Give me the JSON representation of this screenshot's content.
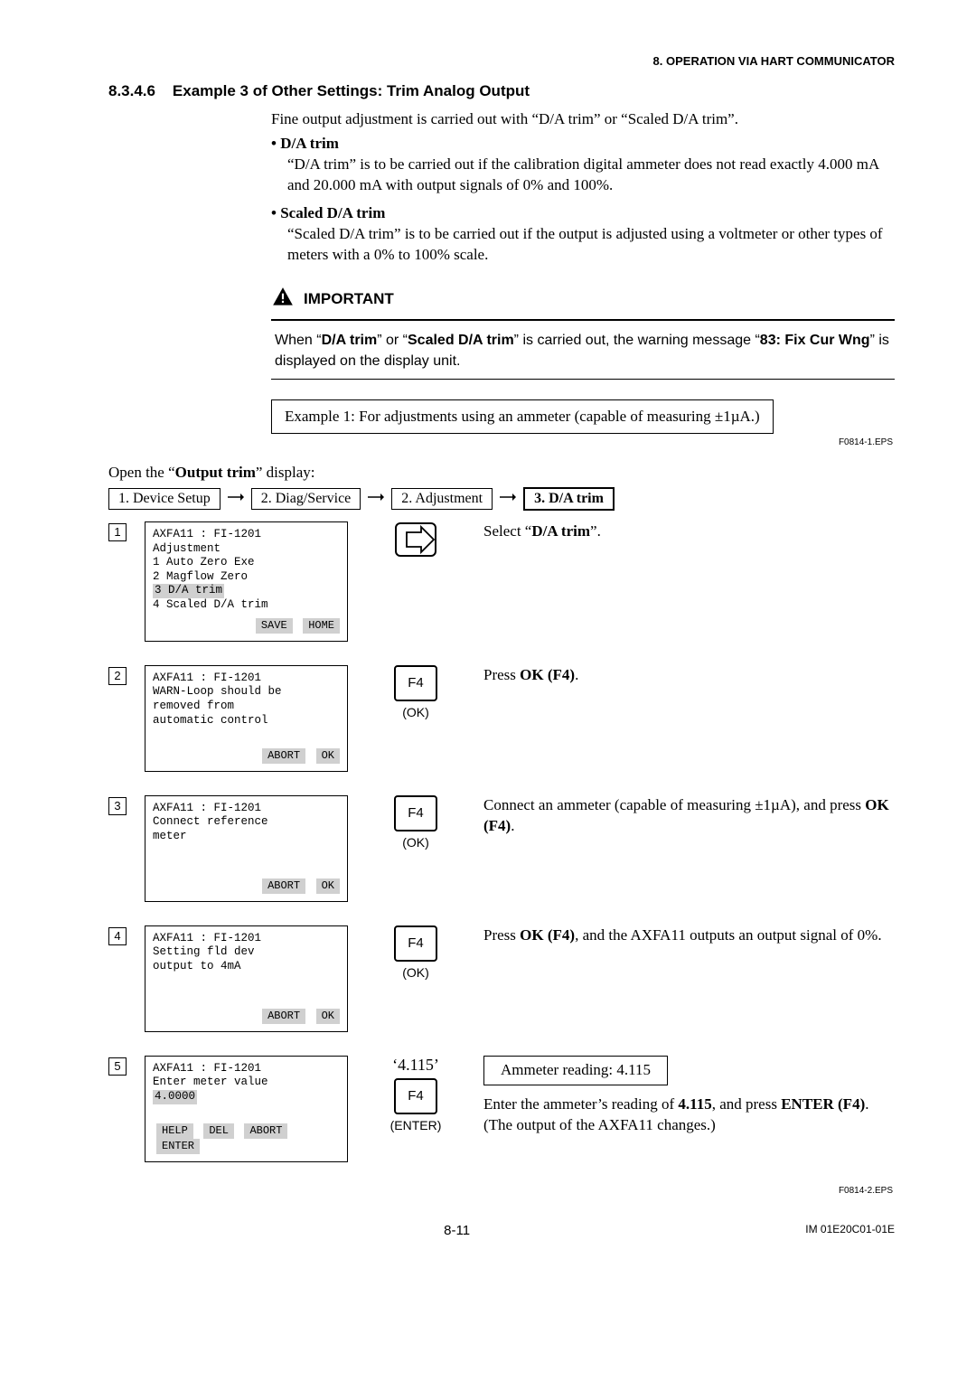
{
  "header": {
    "chapter": "8.  OPERATION VIA HART COMMUNICATOR"
  },
  "section": {
    "number": "8.3.4.6",
    "title": "Example 3 of Other Settings: Trim Analog Output",
    "intro": "Fine output adjustment is carried out with “D/A trim” or “Scaled D/A trim”.",
    "bullets": [
      {
        "title": "D/A trim",
        "body": "“D/A trim” is to be carried out if the calibration digital ammeter does not read exactly 4.000 mA and 20.000 mA with output signals of 0% and 100%."
      },
      {
        "title": "Scaled D/A trim",
        "body": "“Scaled D/A trim” is to be carried out if the output is adjusted using a voltmeter or other types of meters with a 0% to 100% scale."
      }
    ]
  },
  "important": {
    "label": "IMPORTANT",
    "body_pre": "When “",
    "kw1": "D/A trim",
    "mid1": "” or “",
    "kw2": "Scaled D/A trim",
    "mid2": "” is carried out, the warning message “",
    "kw3": "83: Fix Cur Wng",
    "body_post": "” is displayed on the display unit."
  },
  "example_box": "Example 1: For adjustments using an ammeter (capable of measuring ±1µA.)",
  "eps1": "F0814-1.EPS",
  "open_display_pre": "Open the “",
  "open_display_kw": "Output trim",
  "open_display_post": "” display:",
  "breadcrumb": [
    "1. Device Setup",
    "2. Diag/Service",
    "2. Adjustment",
    "3.  D/A trim"
  ],
  "steps": [
    {
      "n": "1",
      "screen_lines": [
        "AXFA11 : FI-1201",
        "Adjustment",
        " 1 Auto Zero Exe",
        " 2 Magflow Zero"
      ],
      "screen_sel": " 3 D/A trim",
      "screen_after": [
        " 4 Scaled D/A trim"
      ],
      "buttons": [
        "SAVE",
        "HOME"
      ],
      "key_type": "arrow",
      "desc_plain": "Select “",
      "desc_bold": "D/A trim",
      "desc_tail": "”."
    },
    {
      "n": "2",
      "screen_lines": [
        "AXFA11 : FI-1201",
        "WARN-Loop should be",
        "removed from",
        "automatic control"
      ],
      "buttons": [
        "ABORT",
        "OK"
      ],
      "key_type": "f4",
      "key": "F4",
      "key_label": "(OK)",
      "desc_plain": "Press ",
      "desc_bold": "OK (F4)",
      "desc_tail": "."
    },
    {
      "n": "3",
      "screen_lines": [
        "AXFA11 : FI-1201",
        "Connect reference",
        "meter"
      ],
      "buttons": [
        "ABORT",
        "OK"
      ],
      "key_type": "f4",
      "key": "F4",
      "key_label": "(OK)",
      "desc_plain": "Connect an ammeter (capable of measuring ±1µA), and press ",
      "desc_bold": "OK (F4)",
      "desc_tail": "."
    },
    {
      "n": "4",
      "screen_lines": [
        "AXFA11 : FI-1201",
        "Setting fld dev",
        "output to 4mA"
      ],
      "buttons": [
        "ABORT",
        "OK"
      ],
      "key_type": "f4",
      "key": "F4",
      "key_label": "(OK)",
      "desc_plain": "Press ",
      "desc_bold": "OK (F4)",
      "desc_tail": ", and the AXFA11 outputs an output signal of 0%."
    },
    {
      "n": "5",
      "screen_lines": [
        "AXFA11 : FI-1201",
        "Enter meter value"
      ],
      "screen_hl": "       4.0000",
      "buttons_left": [
        "HELP",
        "DEL",
        "ABORT",
        "ENTER"
      ],
      "key_type": "typed",
      "typed": "‘4.115’",
      "key": "F4",
      "key_label": "(ENTER)",
      "ammeter_box": "Ammeter reading: 4.115",
      "desc5_a": "Enter the ammeter’s reading of ",
      "desc5_b": "4.115",
      "desc5_c": ", and press ",
      "desc5_d": "ENTER (F4)",
      "desc5_e": ". (The output of the AXFA11 changes.)"
    }
  ],
  "eps2": "F0814-2.EPS",
  "footer": {
    "page": "8-11",
    "doc": "IM 01E20C01-01E"
  }
}
